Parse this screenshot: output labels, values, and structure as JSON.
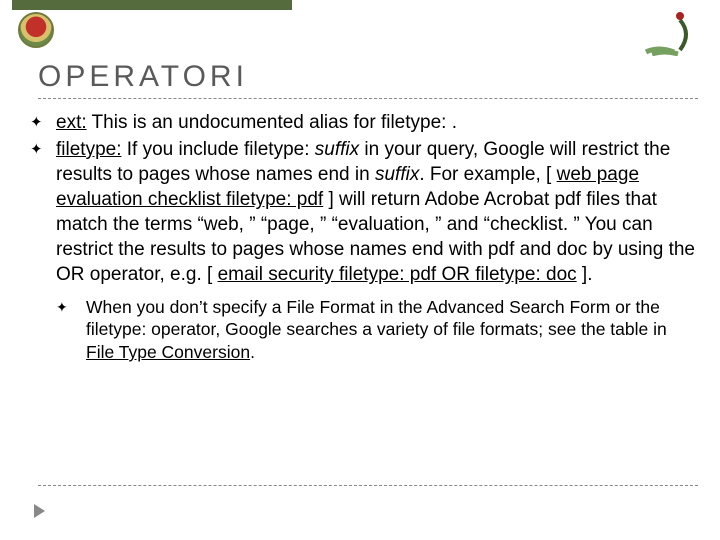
{
  "title": "OPERATORI",
  "bullets": [
    {
      "label": "ext:",
      "rest": " This is an undocumented alias for filetype: ."
    },
    {
      "label": "filetype:",
      "rest": " If you include filetype: ",
      "suffix_word": "suffix",
      "cont1": " in your query, Google will restrict the results to pages whose names end in ",
      "suffix_word2": "suffix",
      "cont2": ". For example, [ ",
      "link1": "web page evaluation checklist filetype: pdf",
      "cont3": " ] will return Adobe Acrobat pdf files that match the terms “web, ” “page, ” “evaluation, ” and “checklist. ” You can restrict the results to pages whose names end with pdf and doc by using the OR operator, e.g. [  ",
      "link2": "email security filetype: pdf OR filetype: doc",
      "cont4": " ]."
    }
  ],
  "sub": {
    "t1": "When you don’t specify a File Format in the Advanced Search Form or the filetype: operator, Google searches a variety of file formats; see the table in ",
    "link": "File Type Conversion",
    "t2": "."
  }
}
